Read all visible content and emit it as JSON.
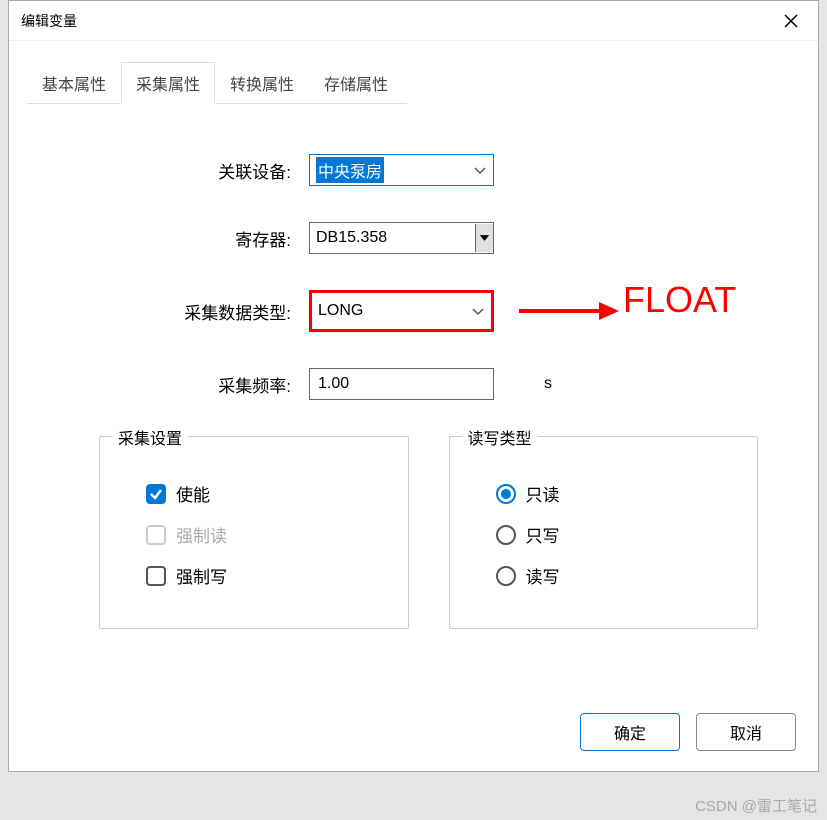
{
  "title": "编辑变量",
  "tabs": [
    "基本属性",
    "采集属性",
    "转换属性",
    "存储属性"
  ],
  "activeTabIndex": 1,
  "form": {
    "device_label": "关联设备:",
    "device_value": "中央泵房",
    "register_label": "寄存器:",
    "register_value": "DB15.358",
    "datatype_label": "采集数据类型:",
    "datatype_value": "LONG",
    "freq_label": "采集频率:",
    "freq_value": "1.00",
    "freq_unit": "s"
  },
  "group_collect": {
    "title": "采集设置",
    "enable_label": "使能",
    "force_read_label": "强制读",
    "force_write_label": "强制写"
  },
  "group_rw": {
    "title": "读写类型",
    "readonly_label": "只读",
    "writeonly_label": "只写",
    "readwrite_label": "读写"
  },
  "annotation": "FLOAT",
  "buttons": {
    "ok": "确定",
    "cancel": "取消"
  },
  "watermark": "CSDN @雷工笔记"
}
